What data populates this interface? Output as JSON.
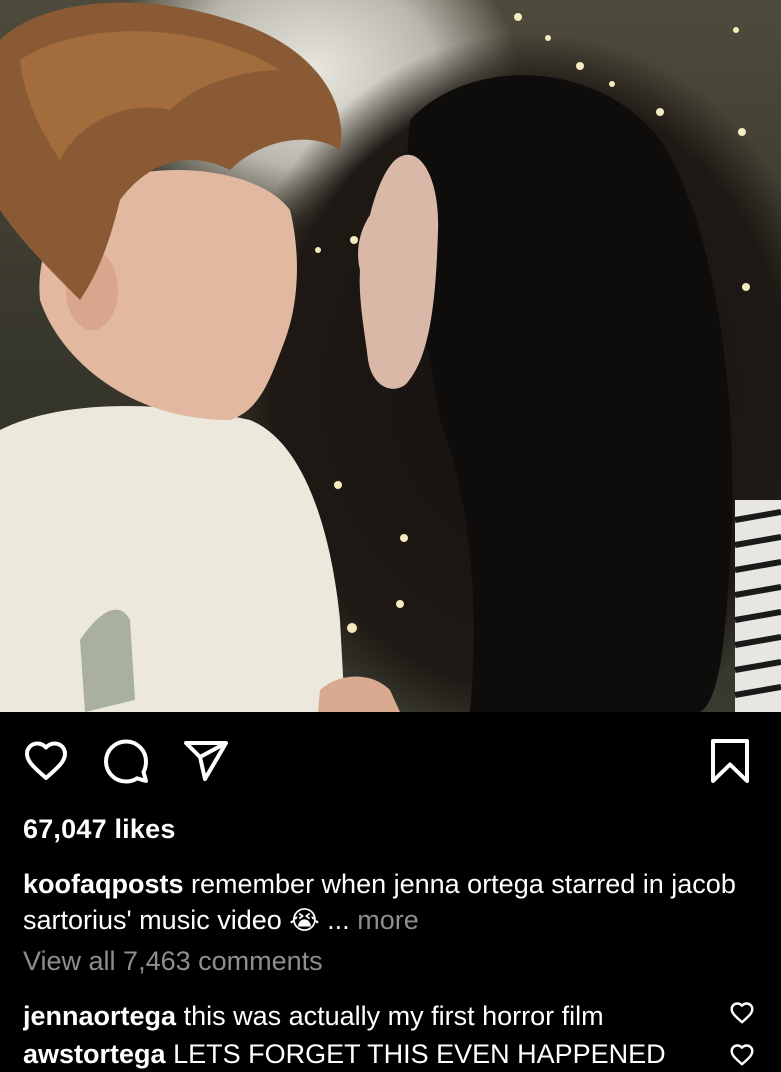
{
  "post": {
    "photo_alt": "",
    "likes": "67,047 likes",
    "caption": {
      "username": "koofaqposts",
      "text": "remember when jenna ortega starred in jacob sartorius' music video",
      "emoji": "😭",
      "ellipsis": "...",
      "more_label": "more"
    },
    "view_comments": "View all 7,463 comments",
    "comments": [
      {
        "username": "jennaortega",
        "text": "this was actually my first horror film"
      },
      {
        "username": "awstortega",
        "text": "LETS FORGET THIS EVEN HAPPENED"
      }
    ]
  },
  "icons": [
    "heart-icon",
    "comment-icon",
    "send-icon",
    "bookmark-icon"
  ],
  "colors": {
    "background": "#000000",
    "text": "#ffffff",
    "muted": "#8e8e8e"
  }
}
